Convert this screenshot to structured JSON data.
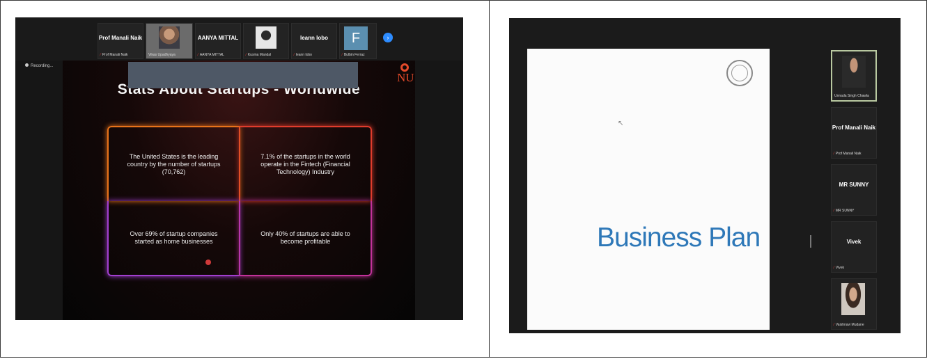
{
  "left": {
    "participants": [
      {
        "name": "Prof Manali Naik",
        "label": "Prof Manali Naik",
        "video": false
      },
      {
        "name": "",
        "label": "Vikas Upadhyaya",
        "video": true
      },
      {
        "name": "AANYA MITTAL",
        "label": "AANYA MITTAL",
        "video": false
      },
      {
        "name": "",
        "label": "Kusma Mandal",
        "video": true
      },
      {
        "name": "leann lobo",
        "label": "leann lobo",
        "video": false
      },
      {
        "name": "F",
        "label": "Bulbin Ferraz",
        "video": false
      }
    ],
    "next_button": "›",
    "recording": "Recording...",
    "slide": {
      "title": "Stats About Startups - Worldwide",
      "logo": "NU",
      "facts": [
        "The United States is the leading country by the number of startups (70,762)",
        "7.1% of the startups in the world operate in the Fintech (Financial Technology) Industry",
        "Over 69% of startup companies started as home businesses",
        "Only 40% of startups are able to become profitable"
      ]
    }
  },
  "right": {
    "slide": {
      "title": "Business Plan"
    },
    "participants": [
      {
        "name": "",
        "label": "Unnada Singh Chawla",
        "video": true
      },
      {
        "name": "Prof Manali Naik",
        "label": "Prof Manali Naik",
        "video": false
      },
      {
        "name": "MR SUNNY",
        "label": "MR SUNNY",
        "video": false
      },
      {
        "name": "Vivek",
        "label": "Vivek",
        "video": false
      },
      {
        "name": "",
        "label": "Vaishnavi Mudane",
        "video": true
      }
    ]
  }
}
